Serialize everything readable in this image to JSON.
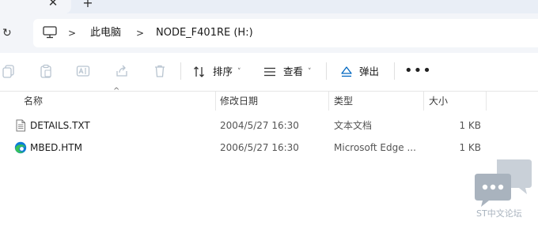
{
  "tabs": {
    "close_glyph": "✕",
    "new_glyph": "+"
  },
  "address": {
    "refresh_glyph": "↻",
    "crumbs": [
      "此电脑",
      "NODE_F401RE (H:)"
    ],
    "separator": ">"
  },
  "toolbar": {
    "sort_label": "排序",
    "view_label": "查看",
    "eject_label": "弹出",
    "more_glyph": "•••",
    "caret": "˅"
  },
  "columns": {
    "name": "名称",
    "date": "修改日期",
    "type": "类型",
    "size": "大小",
    "sort_glyph": "^"
  },
  "files": [
    {
      "name": "DETAILS.TXT",
      "date": "2004/5/27 16:30",
      "type": "文本文档",
      "size": "1 KB",
      "icon": "text-file-icon"
    },
    {
      "name": "MBED.HTM",
      "date": "2006/5/27 16:30",
      "type": "Microsoft Edge ...",
      "size": "1 KB",
      "icon": "edge-html-icon"
    }
  ],
  "watermark": {
    "text": "ST中文论坛"
  },
  "colors": {
    "accent": "#0067c0",
    "edge_blue": "#0c7bd8",
    "edge_green": "#36c15a",
    "watermark": "#a9b3be"
  }
}
